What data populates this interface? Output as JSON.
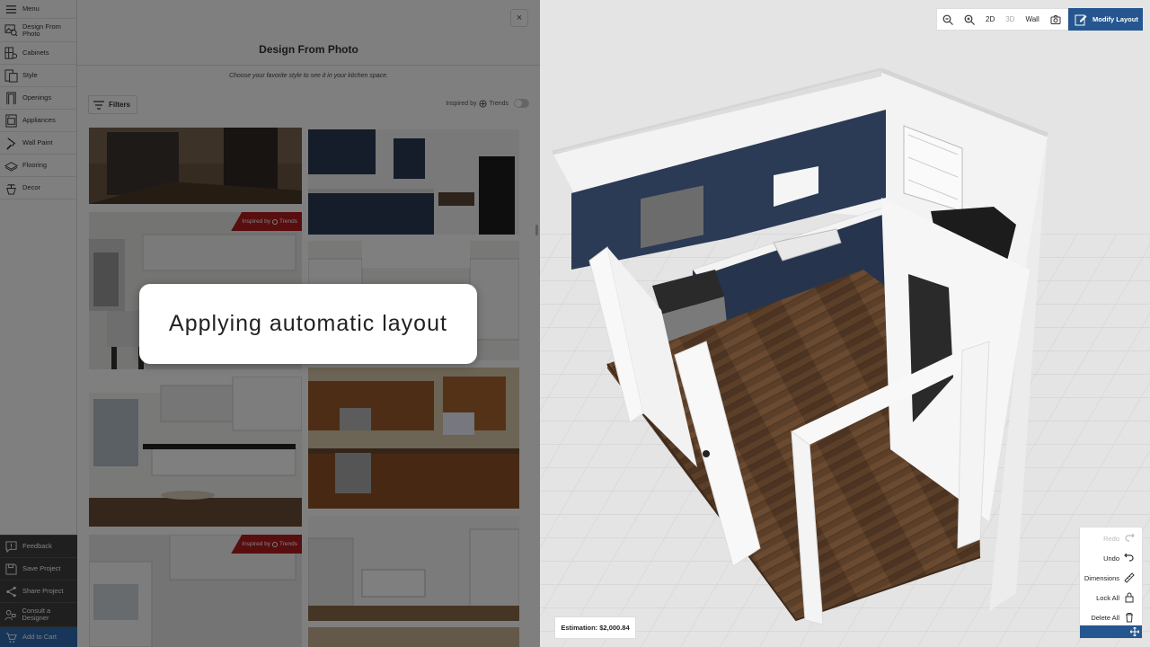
{
  "nav": {
    "items": [
      {
        "label": "Menu",
        "icon": "menu-icon"
      },
      {
        "label": "Design From Photo",
        "icon": "photo-search-icon"
      },
      {
        "label": "Cabinets",
        "icon": "cabinet-icon"
      },
      {
        "label": "Style",
        "icon": "style-icon"
      },
      {
        "label": "Openings",
        "icon": "door-icon"
      },
      {
        "label": "Appliances",
        "icon": "appliance-icon"
      },
      {
        "label": "Wall Paint",
        "icon": "paint-roller-icon"
      },
      {
        "label": "Flooring",
        "icon": "flooring-icon"
      },
      {
        "label": "Decor",
        "icon": "plant-icon"
      }
    ],
    "bottom": [
      {
        "label": "Feedback",
        "icon": "feedback-icon"
      },
      {
        "label": "Save Project",
        "icon": "save-icon"
      },
      {
        "label": "Share Project",
        "icon": "share-icon"
      },
      {
        "label": "Consult a Designer",
        "icon": "designer-icon"
      },
      {
        "label": "Add to Cart",
        "icon": "cart-icon"
      }
    ]
  },
  "panel": {
    "title": "Design From Photo",
    "close": "×",
    "subtitle": "Choose your favorite style to see it in your kitchen space.",
    "filters_label": "Filters",
    "inspired_label": "Inspired by",
    "trends_label": "Trends",
    "badge_text": "Inspired by",
    "badge_brand": "Trends"
  },
  "toast": {
    "message": "Applying automatic layout"
  },
  "toolbar": {
    "zoom_in_icon": "zoom-in-icon",
    "zoom_out_icon": "zoom-out-icon",
    "btn_2d": "2D",
    "btn_3d": "3D",
    "btn_wall": "Wall",
    "camera_icon": "camera-icon",
    "modify_layout": "Modify Layout"
  },
  "actions": {
    "redo": "Redo",
    "undo": "Undo",
    "dimensions": "Dimensions",
    "lock_all": "Lock All",
    "delete_all": "Delete All"
  },
  "estimation": {
    "label": "Estimation: $2,000.84"
  },
  "colors": {
    "accent": "#26568f",
    "cart": "#2f6db5",
    "badge": "#b01c1c",
    "cabinet_navy": "#2b3a55"
  }
}
